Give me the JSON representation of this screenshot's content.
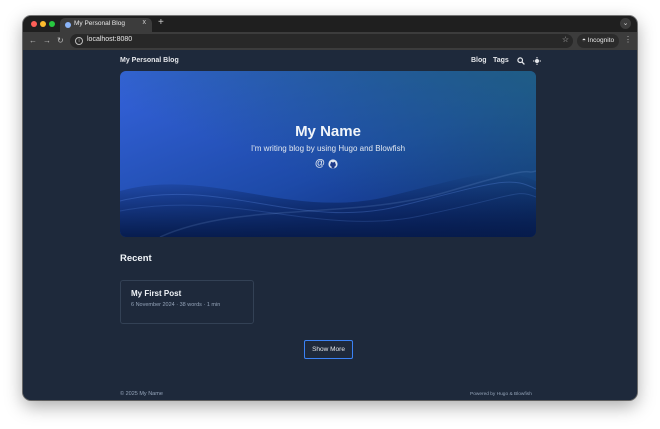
{
  "browser": {
    "tab_title": "My Personal Blog",
    "tab_close": "x",
    "new_tab": "+",
    "url": "localhost:8080",
    "incognito_label": "Incognito",
    "icons": [
      "back-icon",
      "forward-icon",
      "reload-icon",
      "info-icon",
      "star-icon",
      "incognito-icon",
      "kebab-menu-icon",
      "tab-search-icon"
    ]
  },
  "site": {
    "title": "My Personal Blog",
    "nav": [
      {
        "label": "Blog"
      },
      {
        "label": "Tags"
      }
    ],
    "nav_icons": [
      "search-icon",
      "appearance-icon"
    ]
  },
  "hero": {
    "name": "My Name",
    "tagline": "I'm writing blog by using Hugo and Blowfish",
    "icons": [
      "email-icon",
      "github-icon"
    ],
    "colors": {
      "start": "#2f5fd8",
      "end": "#0b2a6b",
      "teal": "#1e4f7a"
    }
  },
  "recent": {
    "heading": "Recent",
    "posts": [
      {
        "title": "My First Post",
        "meta": "6 November 2024 · 38 words · 1 min"
      }
    ],
    "show_more": "Show More"
  },
  "footer": {
    "copyright": "© 2025 My Name",
    "powered_by": "Powered by Hugo & Blowfish"
  },
  "colors": {
    "page_bg": "#1e293b",
    "accent": "#3b82f6",
    "text": "#f1f5f9",
    "muted": "#94a3b8"
  }
}
